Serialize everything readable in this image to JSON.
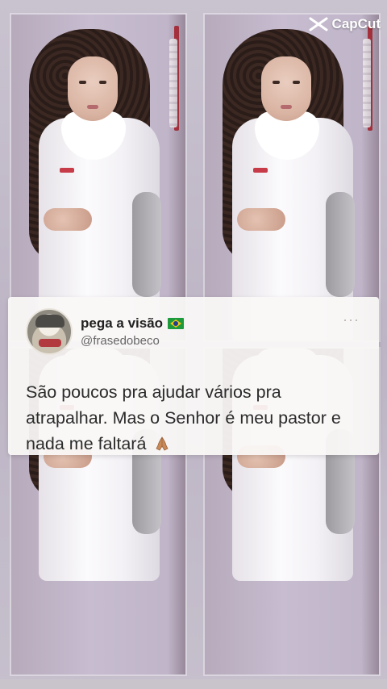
{
  "watermark": {
    "label": "CapCut",
    "icon": "capcut-logo-icon"
  },
  "tweet": {
    "display_name": "pega a visão",
    "flag": "brazil-flag-icon",
    "handle": "@frasedobeco",
    "text": "São poucos pra ajudar vários pra atrapalhar. Mas o Senhor é meu pastor e nada me faltará",
    "emoji": "praying-hands-icon",
    "more": "···"
  },
  "colors": {
    "card_bg": "#faf8f6",
    "wall": "#c7bcd0",
    "coat": "#f6f4f8",
    "accent_red": "#b42e3a"
  }
}
